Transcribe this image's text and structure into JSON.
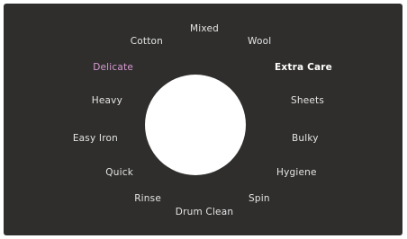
{
  "selector": {
    "selected": "Delicate",
    "colors": {
      "panel": "#2f2e2d",
      "label": "#e4e4e4",
      "selected": "#d79ad0",
      "dial": "#ffffff"
    },
    "programs": [
      {
        "id": "mixed",
        "label": "Mixed"
      },
      {
        "id": "wool",
        "label": "Wool"
      },
      {
        "id": "extra-care",
        "label": "Extra Care"
      },
      {
        "id": "sheets",
        "label": "Sheets"
      },
      {
        "id": "bulky",
        "label": "Bulky"
      },
      {
        "id": "hygiene",
        "label": "Hygiene"
      },
      {
        "id": "spin",
        "label": "Spin"
      },
      {
        "id": "drum-clean",
        "label": "Drum Clean"
      },
      {
        "id": "rinse",
        "label": "Rinse"
      },
      {
        "id": "quick",
        "label": "Quick"
      },
      {
        "id": "easy-iron",
        "label": "Easy Iron"
      },
      {
        "id": "heavy",
        "label": "Heavy"
      },
      {
        "id": "delicate",
        "label": "Delicate"
      },
      {
        "id": "cotton",
        "label": "Cotton"
      }
    ]
  }
}
